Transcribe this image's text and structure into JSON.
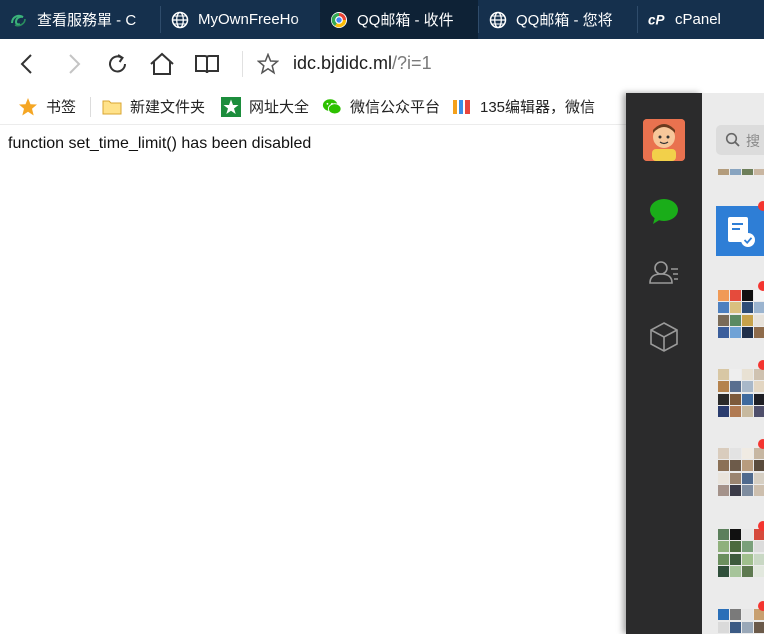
{
  "browser": {
    "tabs": [
      {
        "label": "查看服務單 - C",
        "icon": "cloud-logo-icon",
        "active": false
      },
      {
        "label": "MyOwnFreeHo",
        "icon": "globe-icon",
        "active": false
      },
      {
        "label": "QQ邮箱 - 收件",
        "icon": "qq-mail-icon",
        "active": true
      },
      {
        "label": "QQ邮箱 - 您将",
        "icon": "globe-icon",
        "active": false
      },
      {
        "label": "cPanel",
        "icon": "cpanel-icon",
        "active": false
      }
    ],
    "address": {
      "host": "idc.bjdidc.ml",
      "query": "/?i=1"
    },
    "bookmarks": [
      {
        "label": "书签",
        "icon": "star-icon"
      },
      {
        "label": "新建文件夹",
        "icon": "folder-icon"
      },
      {
        "label": "网址大全",
        "icon": "web-directory-icon"
      },
      {
        "label": "微信公众平台",
        "icon": "wechat-icon"
      },
      {
        "label": "135编辑器，微信",
        "icon": "editor-135-icon"
      }
    ]
  },
  "page": {
    "message": "function set_time_limit() has been disabled"
  },
  "wechat": {
    "search_placeholder": "搜",
    "nav": [
      "chats-icon",
      "contacts-icon",
      "mini-programs-icon"
    ],
    "accent": "#1aad19",
    "badge_color": "#f43530"
  }
}
